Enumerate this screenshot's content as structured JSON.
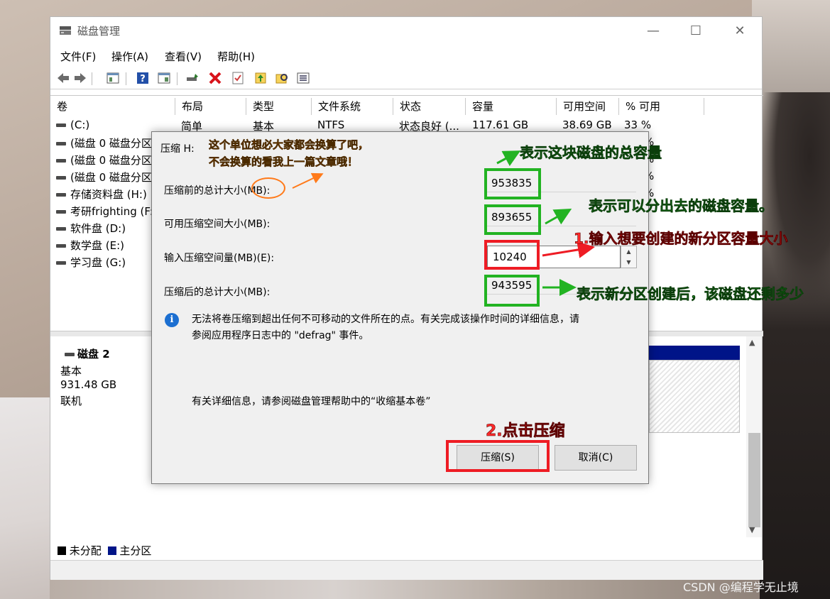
{
  "window": {
    "title": "磁盘管理",
    "controls": {
      "minimize": "—",
      "maximize": "☐",
      "close": "✕"
    }
  },
  "menu": [
    "文件(F)",
    "操作(A)",
    "查看(V)",
    "帮助(H)"
  ],
  "table": {
    "columns": [
      "卷",
      "布局",
      "类型",
      "文件系统",
      "状态",
      "容量",
      "可用空间",
      "% 可用"
    ],
    "rows": [
      {
        "vol": "(C:)",
        "layout": "简单",
        "type": "基本",
        "fs": "NTFS",
        "status": "状态良好 (...",
        "cap": "117.61 GB",
        "free": "38.69 GB",
        "pct": "33 %"
      },
      {
        "vol": "(磁盘 0 磁盘分区",
        "pct": "%"
      },
      {
        "vol": "(磁盘 0 磁盘分区",
        "pct": "%"
      },
      {
        "vol": "(磁盘 0 磁盘分区",
        "pct": "%"
      },
      {
        "vol": "存储资料盘 (H:)",
        "pct": "%"
      },
      {
        "vol": "考研frighting (F:"
      },
      {
        "vol": "软件盘 (D:)"
      },
      {
        "vol": "数学盘 (E:)"
      },
      {
        "vol": "学习盘 (G:)"
      }
    ]
  },
  "disk": {
    "name": "磁盘 2",
    "type": "基本",
    "size": "931.48 GB",
    "status": "联机"
  },
  "legend": {
    "unallocated": "未分配",
    "primary": "主分区",
    "unallocated_color": "#000000",
    "primary_color": "#001488"
  },
  "dialog": {
    "title": "压缩 H:",
    "total_before_label": "压缩前的总计大小(MB):",
    "total_before_value": "953835",
    "available_label": "可用压缩空间大小(MB):",
    "available_value": "893655",
    "input_label": "输入压缩空间量(MB)(E):",
    "input_value": "10240",
    "total_after_label": "压缩后的总计大小(MB):",
    "total_after_value": "943595",
    "info_line1": "无法将卷压缩到超出任何不可移动的文件所在的点。有关完成该操作时间的详细信息，请",
    "info_line2": "参阅应用程序日志中的 \"defrag\" 事件。",
    "help": "有关详细信息，请参阅磁盘管理帮助中的“收缩基本卷”",
    "shrink_button": "压缩(S)",
    "cancel_button": "取消(C)"
  },
  "annotations": {
    "note_line1": "这个单位想必大家都会换算了吧，",
    "note_line2": "不会换算的看我上一篇文章哦！",
    "total_capacity": "表示这块磁盘的总容量",
    "available": "表示可以分出去的磁盘容量。",
    "step1": "1.输入想要创建的新分区容量大小",
    "remaining": "表示新分区创建后，该磁盘还剩多少",
    "step2": "2.点击压缩",
    "green_color": "#22b322",
    "red_color": "#ee1c24",
    "orange_color": "#ff7a00"
  },
  "watermark": "CSDN @编程学无止境"
}
